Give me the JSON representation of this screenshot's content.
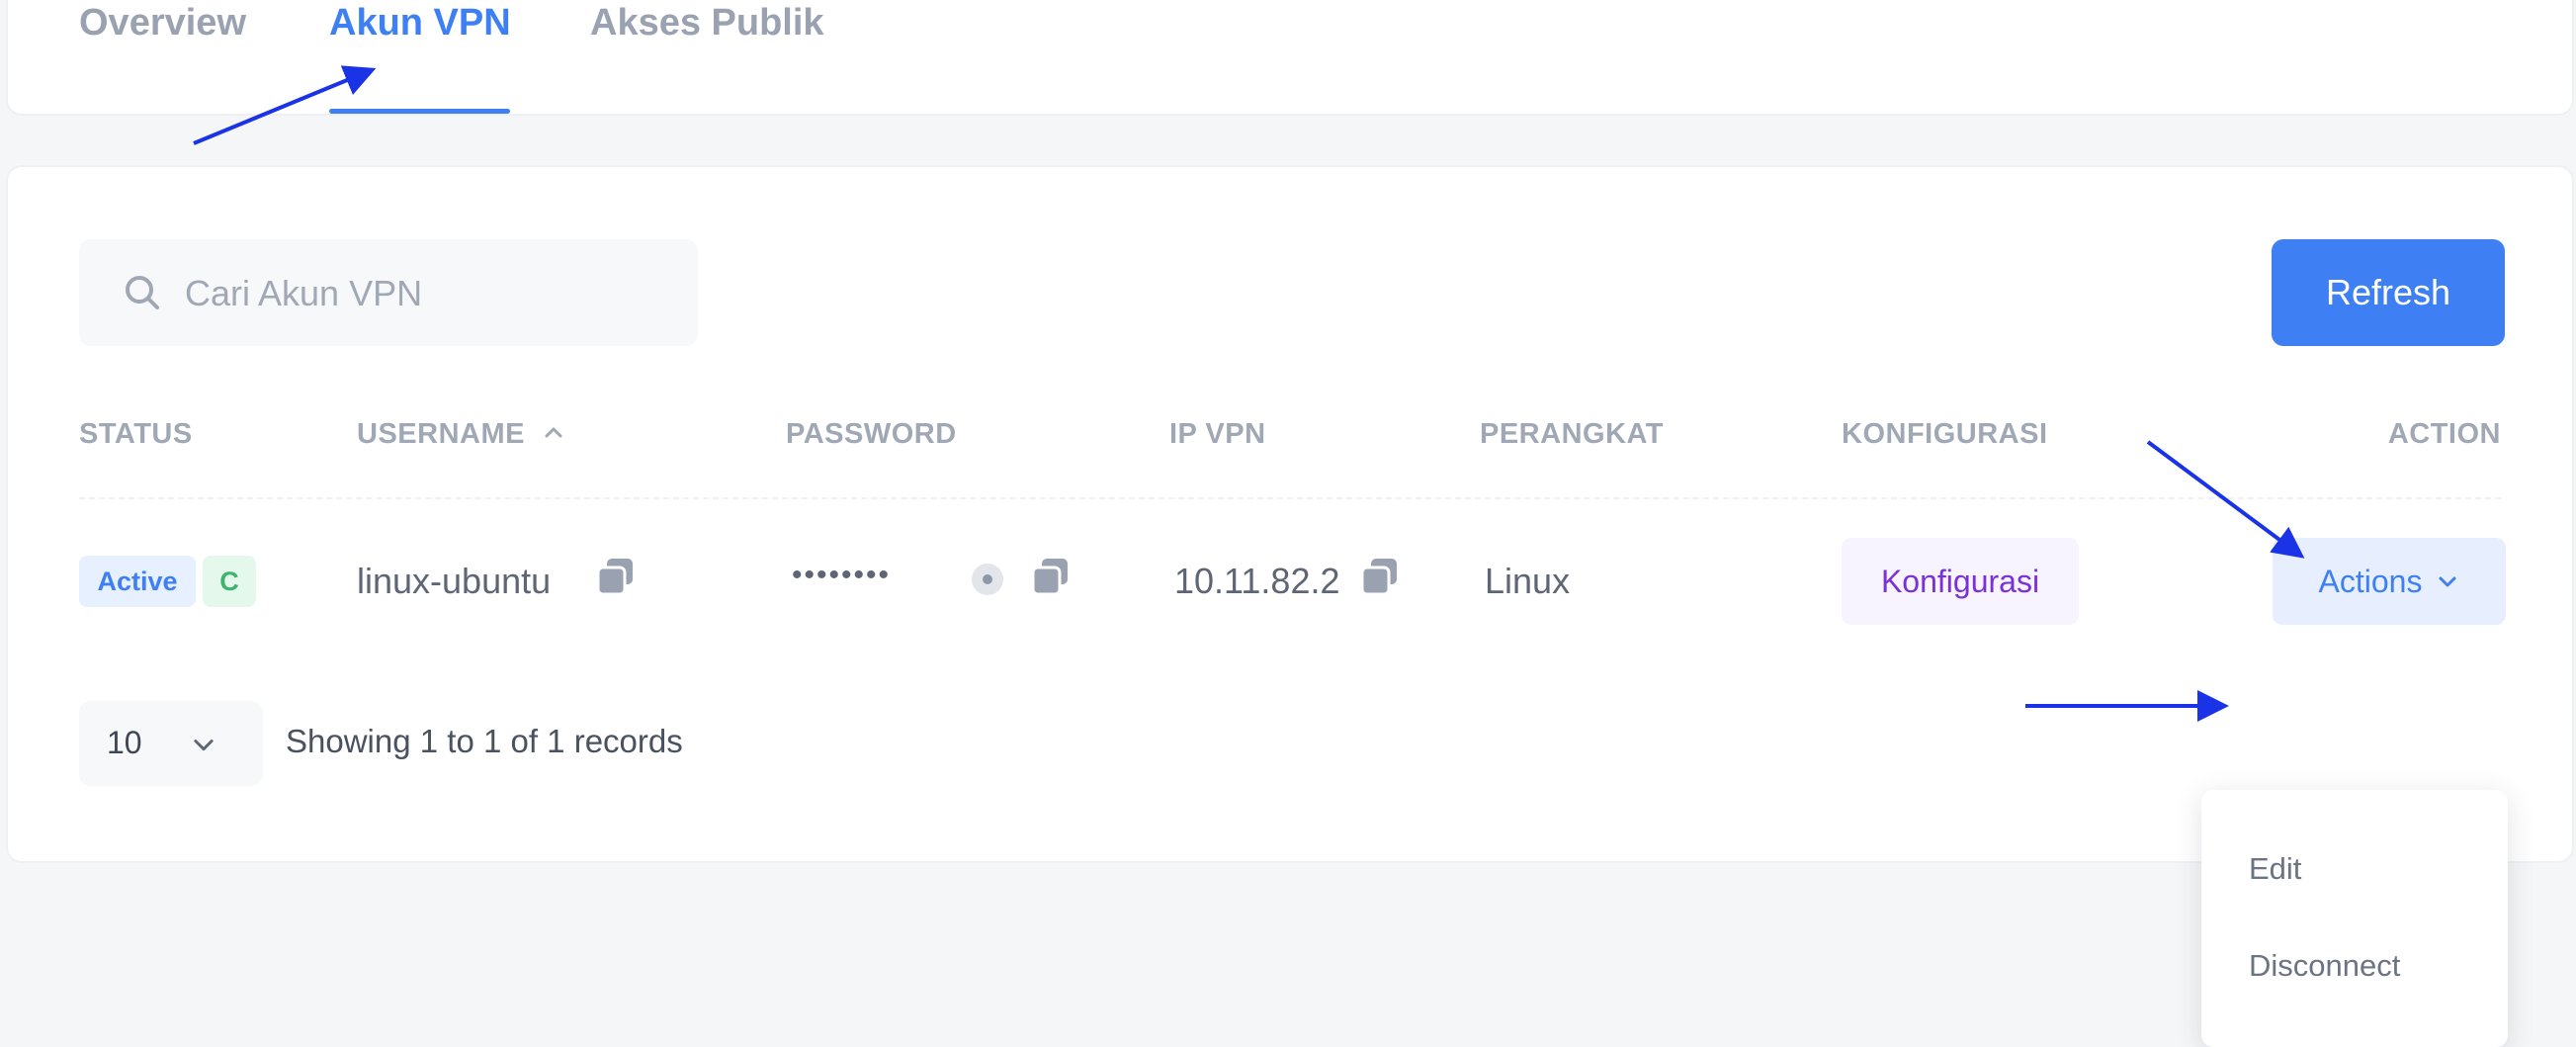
{
  "tabs": [
    {
      "label": "Overview",
      "active": false
    },
    {
      "label": "Akun VPN",
      "active": true
    },
    {
      "label": "Akses Publik",
      "active": false
    }
  ],
  "search": {
    "placeholder": "Cari Akun VPN",
    "value": ""
  },
  "toolbar": {
    "refresh_label": "Refresh"
  },
  "table": {
    "headers": {
      "status": "STATUS",
      "username": "USERNAME",
      "password": "PASSWORD",
      "ip_vpn": "IP VPN",
      "perangkat": "PERANGKAT",
      "konfigurasi": "KONFIGURASI",
      "action": "ACTION"
    },
    "sort": {
      "column": "username",
      "direction": "ascending",
      "icon": "chevron-up-icon"
    },
    "rows": [
      {
        "status": "Active",
        "status_secondary": "C",
        "username": "linux-ubuntu",
        "password_masked": "••••••••",
        "ip_vpn": "10.11.82.2",
        "perangkat": "Linux",
        "konfigurasi_label": "Konfigurasi",
        "actions_label": "Actions"
      }
    ]
  },
  "actions_menu": {
    "items": [
      "Edit",
      "Disconnect"
    ]
  },
  "pagination": {
    "page_size": "10",
    "records_text": "Showing 1 to 1 of 1 records"
  },
  "colors": {
    "accent": "#3e80f3",
    "annotation_arrow": "#1a33e6",
    "status_active_bg": "#e6f0ff",
    "status_active_text": "#3e80f3",
    "status_c_bg": "#e5f8ec",
    "status_c_text": "#3cb56a",
    "konfigurasi_text": "#7a31d6"
  }
}
